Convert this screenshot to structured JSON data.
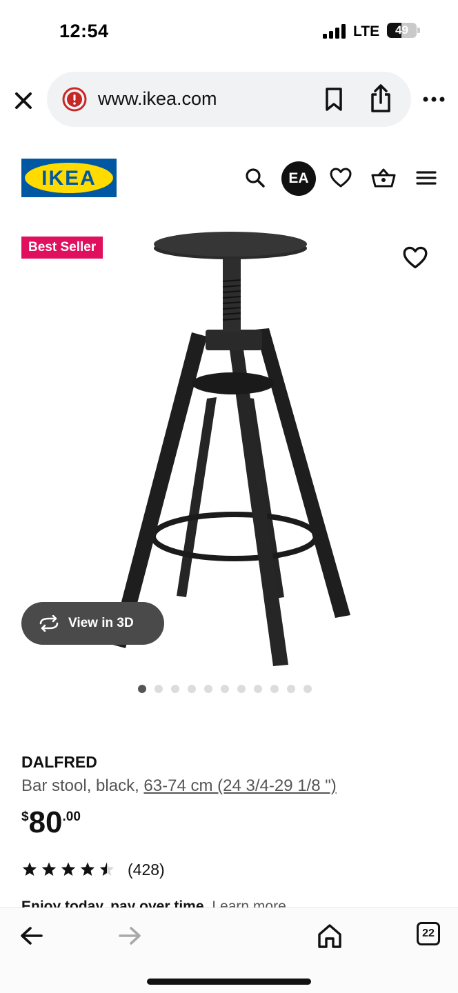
{
  "status_bar": {
    "time": "12:54",
    "network": "LTE",
    "battery": "49",
    "battery_level": 0.49
  },
  "browser": {
    "url": "www.ikea.com"
  },
  "header": {
    "logo_text": "IKEA",
    "avatar_initials": "EA"
  },
  "product_media": {
    "badge": "Best Seller",
    "view3d_label": "View in 3D",
    "image_count": 11,
    "active_index": 0
  },
  "product": {
    "name": "DALFRED",
    "description": "Bar stool, black, ",
    "dimensions": "63-74 cm (24 3/4-29 1/8 \")",
    "price_currency": "$",
    "price_integer": "80",
    "price_decimal": ".00",
    "rating": 4.5,
    "rating_count": "(428)",
    "finance_text": "Enjoy today, pay over time.",
    "learn_more": "Learn more"
  },
  "bottom_bar": {
    "tabs_count": "22"
  },
  "colors": {
    "ikea_blue": "#0058a3",
    "ikea_yellow": "#ffdb00",
    "badge": "#e0105e"
  },
  "icons": [
    "close-icon",
    "warning-icon",
    "bookmark-icon",
    "share-icon",
    "more-icon",
    "search-icon",
    "heart-icon",
    "basket-icon",
    "menu-icon",
    "rotate-icon",
    "star-icon",
    "back-arrow-icon",
    "forward-arrow-icon",
    "home-icon",
    "tabs-icon"
  ]
}
